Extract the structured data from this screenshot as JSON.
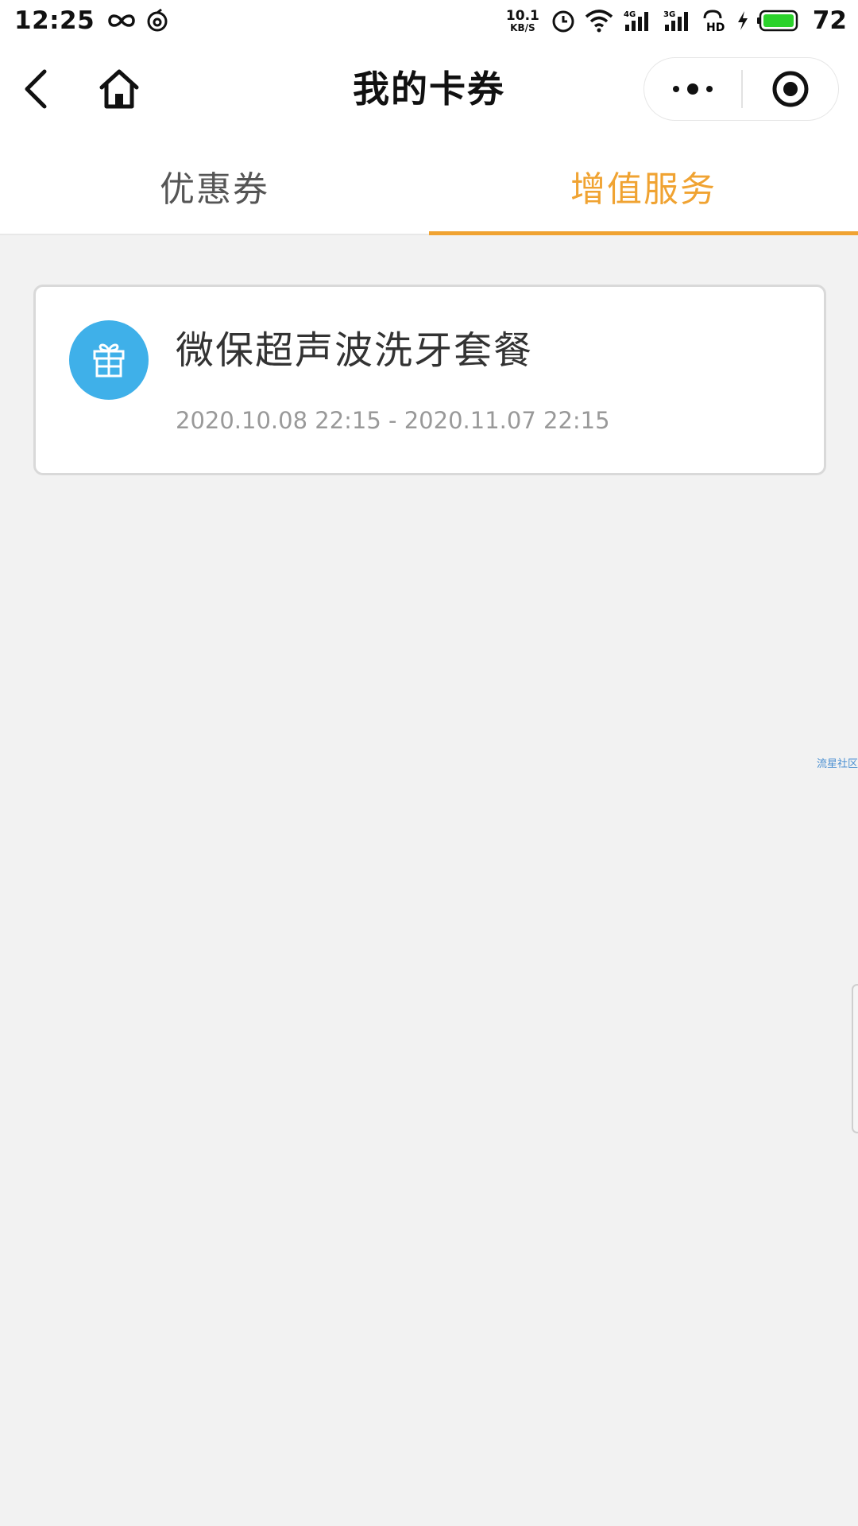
{
  "status_bar": {
    "time": "12:25",
    "net_speed_value": "10.1",
    "net_speed_unit": "KB/S",
    "battery_percent": "72",
    "icons": [
      "infinity-icon",
      "swirl-icon",
      "alarm-icon",
      "wifi-icon",
      "signal-4g-icon",
      "signal-3g-icon",
      "hd-call-icon",
      "charging-icon",
      "battery-icon"
    ],
    "colors": {
      "battery_fill": "#2bd22b"
    }
  },
  "nav": {
    "title": "我的卡券",
    "icons": {
      "back": "chevron-left-icon",
      "home": "home-icon",
      "more": "more-dots-icon",
      "close": "target-circle-icon"
    }
  },
  "tabs": {
    "items": [
      {
        "label": "优惠券",
        "active": false
      },
      {
        "label": "增值服务",
        "active": true
      }
    ],
    "colors": {
      "active": "#f0a332",
      "inactive": "#555555"
    }
  },
  "card": {
    "title": "微保超声波洗牙套餐",
    "date_range": "2020.10.08 22:15 - 2020.11.07 22:15",
    "icon": "gift-icon",
    "colors": {
      "icon_bg": "#3fb0e9"
    }
  },
  "watermark": "流星社区"
}
